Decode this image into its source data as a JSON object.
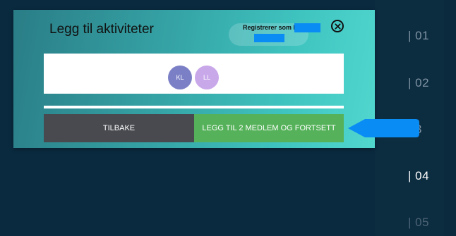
{
  "timeline": {
    "items": [
      "| 01",
      "| 02",
      "03",
      "| 04",
      "| 05"
    ],
    "active_index": 3
  },
  "modal": {
    "title": "Legg til aktiviteter",
    "register_text": "Registrerer som K",
    "members": [
      {
        "initials": "KL",
        "color": "#7b80c6"
      },
      {
        "initials": "LL",
        "color": "#c9a8ea"
      }
    ],
    "back_label": "TILBAKE",
    "continue_label": "LEGG TIL 2 MEDLEM OG FORTSETT"
  },
  "colors": {
    "modal_gradient_start": "#2a7d86",
    "modal_gradient_end": "#52d7cf",
    "back_button": "#484a4f",
    "continue_button": "#56b25a",
    "redaction": "#0a8cf5",
    "pointer": "#0a8cf5"
  },
  "icons": {
    "close": "close-icon"
  }
}
